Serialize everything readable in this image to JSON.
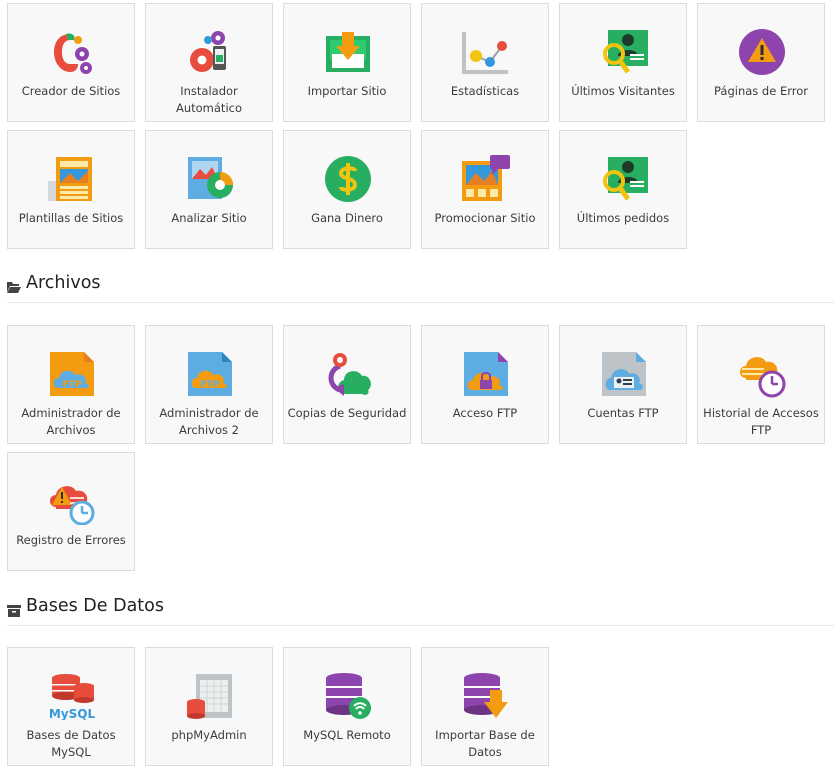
{
  "sections": [
    {
      "title": "Archivos",
      "icon": "folder-open-icon"
    },
    {
      "title": "Bases De Datos",
      "icon": "archive-icon"
    }
  ],
  "tiles": [
    {
      "label": "Creador de Sitios",
      "icon": "site-builder-icon"
    },
    {
      "label": "Instalador Automático",
      "icon": "auto-installer-icon"
    },
    {
      "label": "Importar Sitio",
      "icon": "import-site-icon"
    },
    {
      "label": "Estadísticas",
      "icon": "statistics-icon"
    },
    {
      "label": "Últimos Visitantes",
      "icon": "latest-visitors-icon"
    },
    {
      "label": "Páginas de Error",
      "icon": "error-pages-icon"
    },
    {
      "label": "Plantillas de Sitios",
      "icon": "site-templates-icon"
    },
    {
      "label": "Analizar Sitio",
      "icon": "analyze-site-icon"
    },
    {
      "label": "Gana Dinero",
      "icon": "earn-money-icon"
    },
    {
      "label": "Promocionar Sitio",
      "icon": "promote-site-icon"
    },
    {
      "label": "Últimos pedidos",
      "icon": "latest-orders-icon"
    },
    {
      "label": "Administrador de Archivos",
      "icon": "file-manager-icon"
    },
    {
      "label": "Administrador de Archivos 2",
      "icon": "file-manager-2-icon"
    },
    {
      "label": "Copias de Seguridad",
      "icon": "backups-icon"
    },
    {
      "label": "Acceso FTP",
      "icon": "ftp-access-icon"
    },
    {
      "label": "Cuentas FTP",
      "icon": "ftp-accounts-icon"
    },
    {
      "label": "Historial de Accesos FTP",
      "icon": "ftp-history-icon"
    },
    {
      "label": "Registro de Errores",
      "icon": "error-log-icon"
    },
    {
      "label": "Bases de Datos MySQL",
      "icon": "mysql-databases-icon"
    },
    {
      "label": "phpMyAdmin",
      "icon": "phpmyadmin-icon"
    },
    {
      "label": "MySQL Remoto",
      "icon": "remote-mysql-icon"
    },
    {
      "label": "Importar Base de Datos",
      "icon": "import-database-icon"
    }
  ],
  "icon_text": {
    "ftp_1": "FTP",
    "ftp_2": "FTP",
    "mysql": "MySQL"
  }
}
